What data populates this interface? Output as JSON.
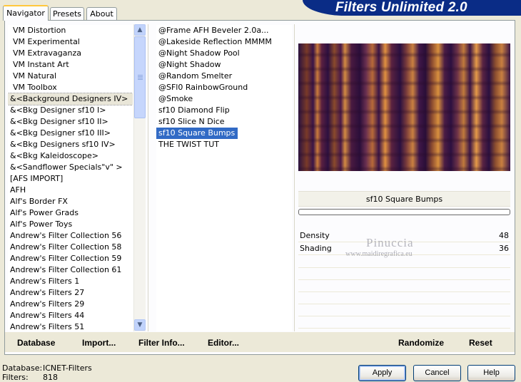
{
  "window": {
    "title": "Filters Unlimited 2.0"
  },
  "tabs": [
    {
      "label": "Navigator",
      "active": true
    },
    {
      "label": "Presets",
      "active": false
    },
    {
      "label": "About",
      "active": false
    }
  ],
  "categories": [
    "VM Distortion",
    "VM Experimental",
    "VM Extravaganza",
    "VM Instant Art",
    "VM Natural",
    "VM Toolbox",
    "&<Background Designers IV>",
    "&<Bkg Designer sf10 I>",
    "&<Bkg Designer sf10 II>",
    "&<Bkg Designer sf10 III>",
    "&<Bkg Designers sf10 IV>",
    "&<Bkg Kaleidoscope>",
    "&<Sandflower Specials\"v\" >",
    "[AFS IMPORT]",
    "AFH",
    "Alf's Border FX",
    "Alf's Power Grads",
    "Alf's Power Toys",
    "Andrew's Filter Collection 56",
    "Andrew's Filter Collection 58",
    "Andrew's Filter Collection 59",
    "Andrew's Filter Collection 61",
    "Andrew's Filters 1",
    "Andrew's Filters 27",
    "Andrew's Filters 29",
    "Andrew's Filters 44",
    "Andrew's Filters 51"
  ],
  "categories_highlighted_index": 6,
  "filters": [
    "@Frame AFH Beveler 2.0a...",
    "@Lakeside Reflection MMMM",
    "@Night Shadow Pool",
    "@Night Shadow",
    "@Random Smelter",
    "@SFl0 RainbowGround",
    "@Smoke",
    "sf10 Diamond Flip",
    "sf10 Slice N Dice",
    "sf10 Square Bumps",
    "THE TWIST TUT"
  ],
  "filters_selected_index": 9,
  "selected_filter_name": "sf10 Square Bumps",
  "progress": 0,
  "params": [
    {
      "label": "Density",
      "value": "48"
    },
    {
      "label": "Shading",
      "value": "36"
    }
  ],
  "watermark": {
    "name": "Pinuccia",
    "site": "www.maidiregrafica.eu"
  },
  "toolbar": {
    "database": "Database",
    "import": "Import...",
    "filter_info": "Filter Info...",
    "editor": "Editor...",
    "randomize": "Randomize",
    "reset": "Reset"
  },
  "status": {
    "database_label": "Database:",
    "database_value": "ICNET-Filters",
    "filters_label": "Filters:",
    "filters_value": "818"
  },
  "buttons": {
    "apply": "Apply",
    "cancel": "Cancel",
    "help": "Help"
  },
  "colors": {
    "banner": "#0a2c86",
    "selection": "#316ac5",
    "face": "#ece9d8"
  }
}
